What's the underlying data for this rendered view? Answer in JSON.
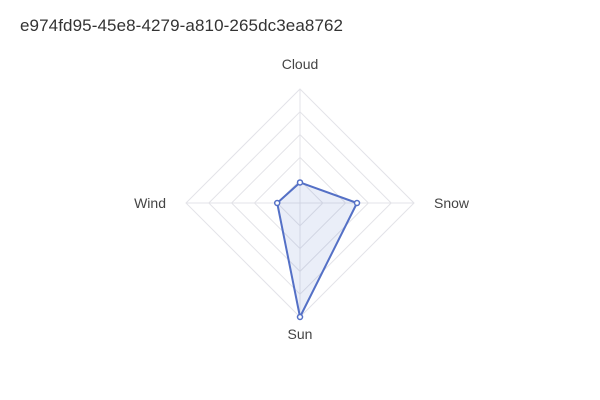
{
  "chart_data": {
    "type": "radar",
    "title": "e974fd95-45e8-4279-a810-265dc3ea8762",
    "indicators": [
      "Cloud",
      "Snow",
      "Sun",
      "Wind"
    ],
    "scale_max": 5,
    "rings": 5,
    "series": [
      {
        "values": [
          0.9,
          2.5,
          5.0,
          1.0
        ]
      }
    ],
    "colors": {
      "line": "#5470c6",
      "area": "rgba(84,112,198,0.12)",
      "grid": "#e3e3e8",
      "label": "#444444"
    }
  }
}
